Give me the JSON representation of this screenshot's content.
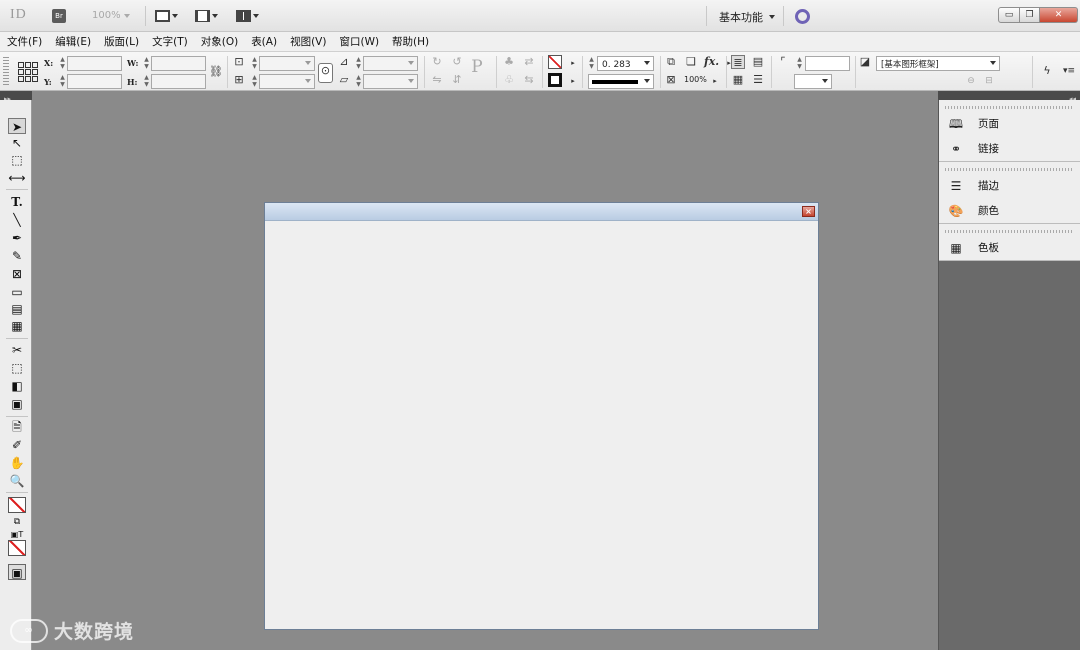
{
  "app": {
    "logo": "ID",
    "bridge_label": "Br",
    "zoom": "100%",
    "workspace": "基本功能",
    "window_buttons": {
      "minimize": "▭",
      "restore": "❐",
      "close": "✕"
    }
  },
  "menu": [
    "文件(F)",
    "编辑(E)",
    "版面(L)",
    "文字(T)",
    "对象(O)",
    "表(A)",
    "视图(V)",
    "窗口(W)",
    "帮助(H)"
  ],
  "control": {
    "x_label": "X:",
    "y_label": "Y:",
    "w_label": "W:",
    "h_label": "H:",
    "stroke_weight": "0. 283",
    "opacity": "100%",
    "fx_label": "fx.",
    "object_style": "[基本图形框架]",
    "p_label": "P"
  },
  "right_panel": {
    "groups": [
      {
        "items": [
          {
            "label": "页面",
            "icon": "pages-icon"
          },
          {
            "label": "链接",
            "icon": "links-icon"
          }
        ]
      },
      {
        "items": [
          {
            "label": "描边",
            "icon": "stroke-icon"
          },
          {
            "label": "颜色",
            "icon": "color-icon"
          }
        ]
      },
      {
        "items": [
          {
            "label": "色板",
            "icon": "swatches-icon"
          }
        ]
      }
    ]
  },
  "watermark": {
    "icon_text": "∞",
    "text": "大数跨境"
  },
  "colors": {
    "accent_ring": "#6f63b6",
    "close_red": "#c84731",
    "doc_title_blue": "#c8d8ec"
  }
}
